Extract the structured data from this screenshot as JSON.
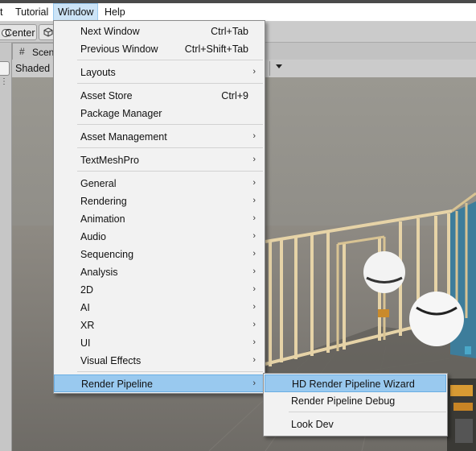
{
  "menubar": {
    "items": [
      {
        "label": "t"
      },
      {
        "label": "Tutorial"
      },
      {
        "label": "Window"
      },
      {
        "label": "Help"
      }
    ]
  },
  "toolbar": {
    "pivot_label": "Center"
  },
  "scene": {
    "tab_label": "Scen",
    "shading_mode": "Shaded"
  },
  "window_menu": {
    "items": [
      {
        "label": "Next Window",
        "shortcut": "Ctrl+Tab"
      },
      {
        "label": "Previous Window",
        "shortcut": "Ctrl+Shift+Tab"
      },
      {
        "label": "Layouts",
        "submenu": true
      },
      {
        "label": "Asset Store",
        "shortcut": "Ctrl+9"
      },
      {
        "label": "Package Manager"
      },
      {
        "label": "Asset Management",
        "submenu": true
      },
      {
        "label": "TextMeshPro",
        "submenu": true
      },
      {
        "label": "General",
        "submenu": true
      },
      {
        "label": "Rendering",
        "submenu": true
      },
      {
        "label": "Animation",
        "submenu": true
      },
      {
        "label": "Audio",
        "submenu": true
      },
      {
        "label": "Sequencing",
        "submenu": true
      },
      {
        "label": "Analysis",
        "submenu": true
      },
      {
        "label": "2D",
        "submenu": true
      },
      {
        "label": "AI",
        "submenu": true
      },
      {
        "label": "XR",
        "submenu": true
      },
      {
        "label": "UI",
        "submenu": true
      },
      {
        "label": "Visual Effects",
        "submenu": true
      },
      {
        "label": "Render Pipeline",
        "submenu": true,
        "highlighted": true
      }
    ],
    "submenu_arrow": "›"
  },
  "render_pipeline_submenu": {
    "items": [
      {
        "label": "HD Render Pipeline Wizard",
        "highlighted": true
      },
      {
        "label": "Render Pipeline Debug"
      },
      {
        "label": "Look Dev"
      }
    ]
  },
  "colors": {
    "menu_highlight": "#99c9ef",
    "menubar_active": "#cce4f7",
    "menu_background": "#f2f2f2"
  },
  "icons": [
    "scene-grid-icon",
    "pivot-center-icon",
    "cube-icon",
    "chevron-right-icon",
    "dropdown-arrow-icon",
    "drag-handle-icon"
  ]
}
